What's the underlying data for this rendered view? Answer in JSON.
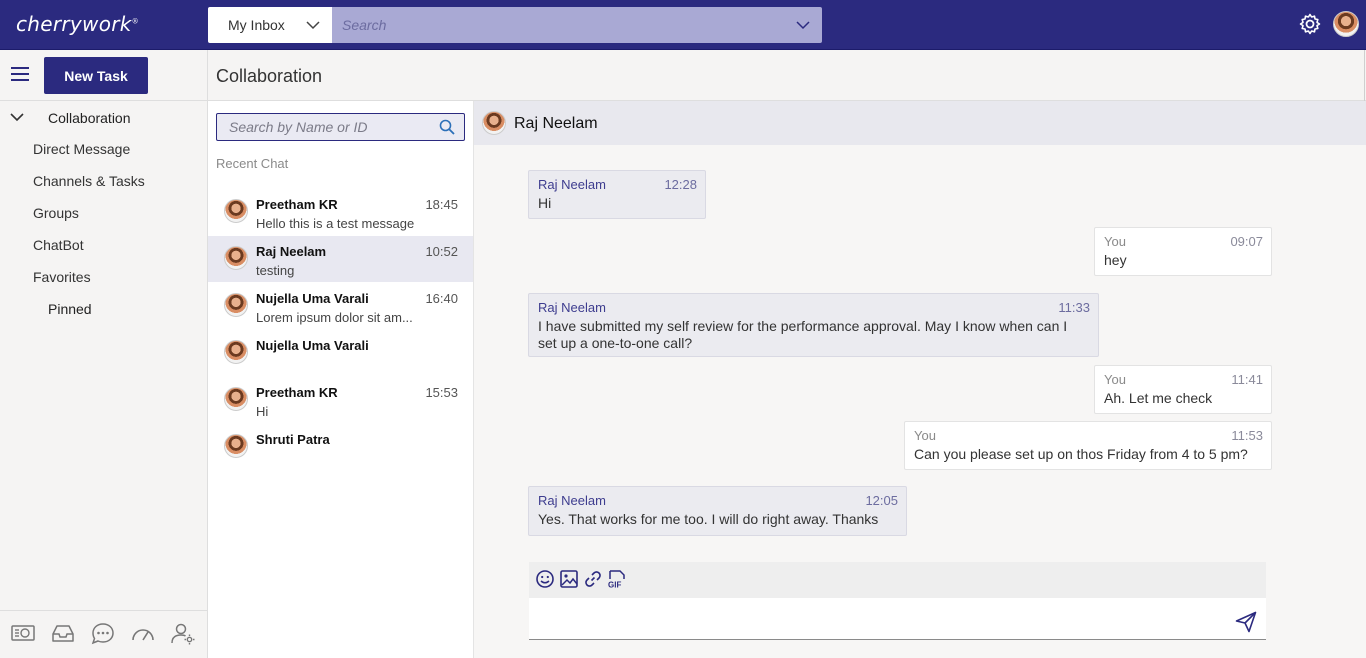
{
  "app": {
    "logo_text": "cherrywork",
    "logo_mark": "®"
  },
  "topbar": {
    "inbox_select": "My Inbox",
    "search_placeholder": "Search",
    "icons": [
      "chevron-down-icon",
      "gear-icon",
      "user-avatar"
    ]
  },
  "subheader": {
    "new_task_label": "New Task",
    "page_title": "Collaboration"
  },
  "leftnav": {
    "section_label": "Collaboration",
    "items": [
      "Direct Message",
      "Channels & Tasks",
      "Groups",
      "ChatBot",
      "Favorites"
    ],
    "pinned_label": "Pinned",
    "bottom_icons": [
      "dashboard-card-icon",
      "inbox-tray-icon",
      "chat-bubble-icon",
      "speedometer-icon",
      "user-settings-icon"
    ]
  },
  "chatlist": {
    "search_placeholder": "Search by Name or ID",
    "recent_label": "Recent Chat",
    "chats": [
      {
        "name": "Preetham KR",
        "time": "18:45",
        "preview": "Hello this is a test message"
      },
      {
        "name": "Raj Neelam",
        "time": "10:52",
        "preview": "testing"
      },
      {
        "name": "Nujella Uma Varali",
        "time": "16:40",
        "preview": "Lorem ipsum dolor sit am..."
      },
      {
        "name": "Nujella Uma Varali",
        "time": "",
        "preview": ""
      },
      {
        "name": "Preetham KR",
        "time": "15:53",
        "preview": "Hi"
      },
      {
        "name": "Shruti Patra",
        "time": "",
        "preview": ""
      }
    ],
    "active_chat": "Raj Neelam"
  },
  "conversation": {
    "contact_name": "Raj Neelam",
    "messages": [
      {
        "from": "Raj Neelam",
        "time": "12:28",
        "text": "Hi"
      },
      {
        "from": "You",
        "time": "09:07",
        "text": "hey"
      },
      {
        "from": "Raj Neelam",
        "time": "11:33",
        "text": "I have submitted my self review for the performance approval. May I know when can I set up a one-to-one call?"
      },
      {
        "from": "You",
        "time": "11:41",
        "text": "Ah. Let me check"
      },
      {
        "from": "You",
        "time": "11:53",
        "text": "Can you please set up on thos Friday from 4 to 5 pm?"
      },
      {
        "from": "Raj Neelam",
        "time": "12:05",
        "text": "Yes. That works for me too. I will do right away. Thanks"
      }
    ],
    "composer": {
      "toolbar_icons": [
        "emoji-icon",
        "image-icon",
        "link-icon",
        "gif-icon"
      ],
      "input_value": "",
      "send_icon": "send-icon"
    }
  },
  "colors": {
    "brand": "#2b2a7f",
    "search_bg": "#a9a9d4",
    "active_row": "#e8e8f1"
  }
}
